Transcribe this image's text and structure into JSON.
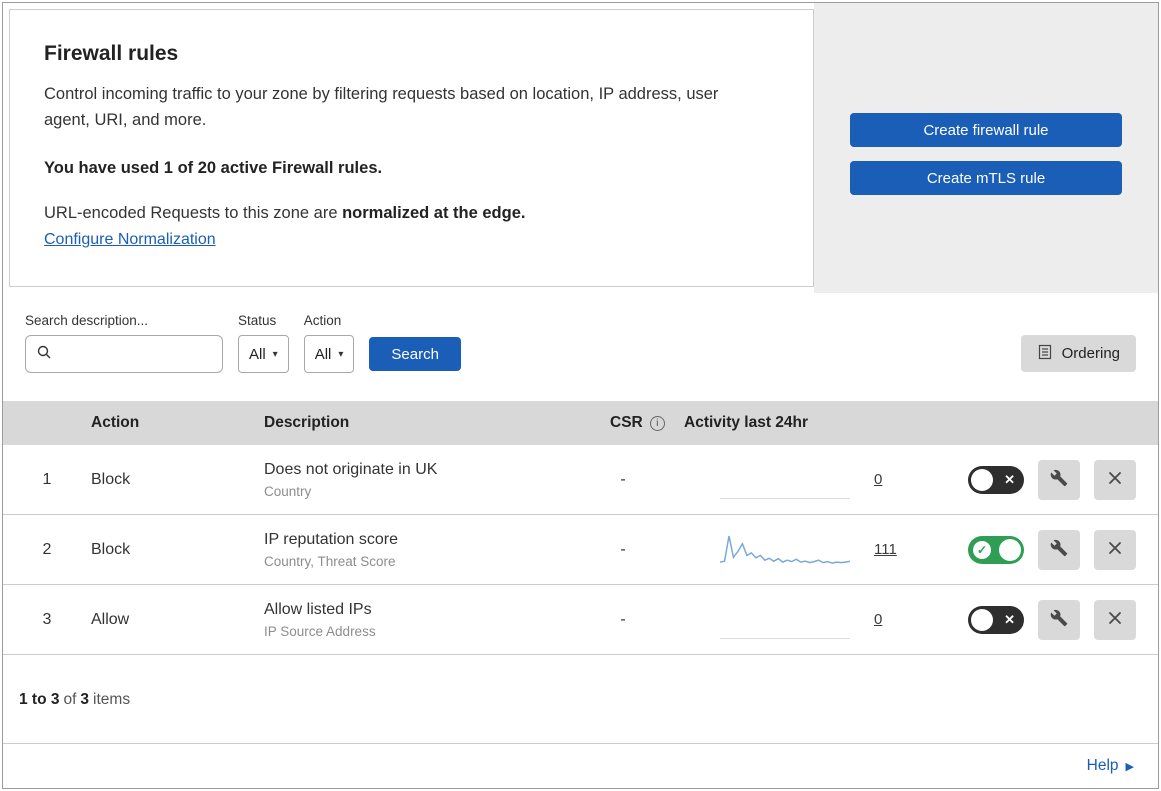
{
  "colors": {
    "accent": "#1a5eb8",
    "toggle_on": "#2f9e55",
    "panel_bg": "#ededed",
    "table_header_bg": "#d8d8d8"
  },
  "icons": {
    "check": "✓",
    "cross": "✕",
    "caret": "▾",
    "arrow_right": "▶",
    "info": "i"
  },
  "header": {
    "title": "Firewall rules",
    "description": "Control incoming traffic to your zone by filtering requests based on location, IP address, user agent, URI, and more.",
    "usage": "You have used 1 of 20 active Firewall rules.",
    "normalization_prefix": "URL-encoded Requests to this zone are ",
    "normalization_bold": "normalized at the edge.",
    "normalization_link": "Configure Normalization",
    "create_firewall_button": "Create firewall rule",
    "create_mtls_button": "Create mTLS rule"
  },
  "filters": {
    "search_label": "Search description...",
    "status_label": "Status",
    "status_value": "All",
    "action_label": "Action",
    "action_value": "All",
    "search_button": "Search",
    "ordering_button": "Ordering"
  },
  "table": {
    "headers": {
      "action": "Action",
      "description": "Description",
      "csr": "CSR",
      "activity": "Activity last 24hr"
    },
    "rows": [
      {
        "index": "1",
        "action": "Block",
        "description": "Does not originate in UK",
        "criteria": "Country",
        "csr": "-",
        "activity_count": "0",
        "enabled": false
      },
      {
        "index": "2",
        "action": "Block",
        "description": "IP reputation score",
        "criteria": "Country, Threat Score",
        "csr": "-",
        "activity_count": "111",
        "enabled": true,
        "sparkline": [
          8,
          10,
          62,
          18,
          30,
          46,
          22,
          27,
          17,
          22,
          12,
          16,
          10,
          15,
          8,
          12,
          9,
          14,
          8,
          10,
          7,
          9,
          12,
          7,
          9,
          6,
          8,
          7,
          8,
          10
        ]
      },
      {
        "index": "3",
        "action": "Allow",
        "description": "Allow listed IPs",
        "criteria": "IP Source Address",
        "csr": "-",
        "activity_count": "0",
        "enabled": false
      }
    ],
    "summary": {
      "range": "1 to 3",
      "of_text": "of",
      "total": "3",
      "items_text": "items"
    }
  },
  "help": {
    "label": "Help"
  }
}
